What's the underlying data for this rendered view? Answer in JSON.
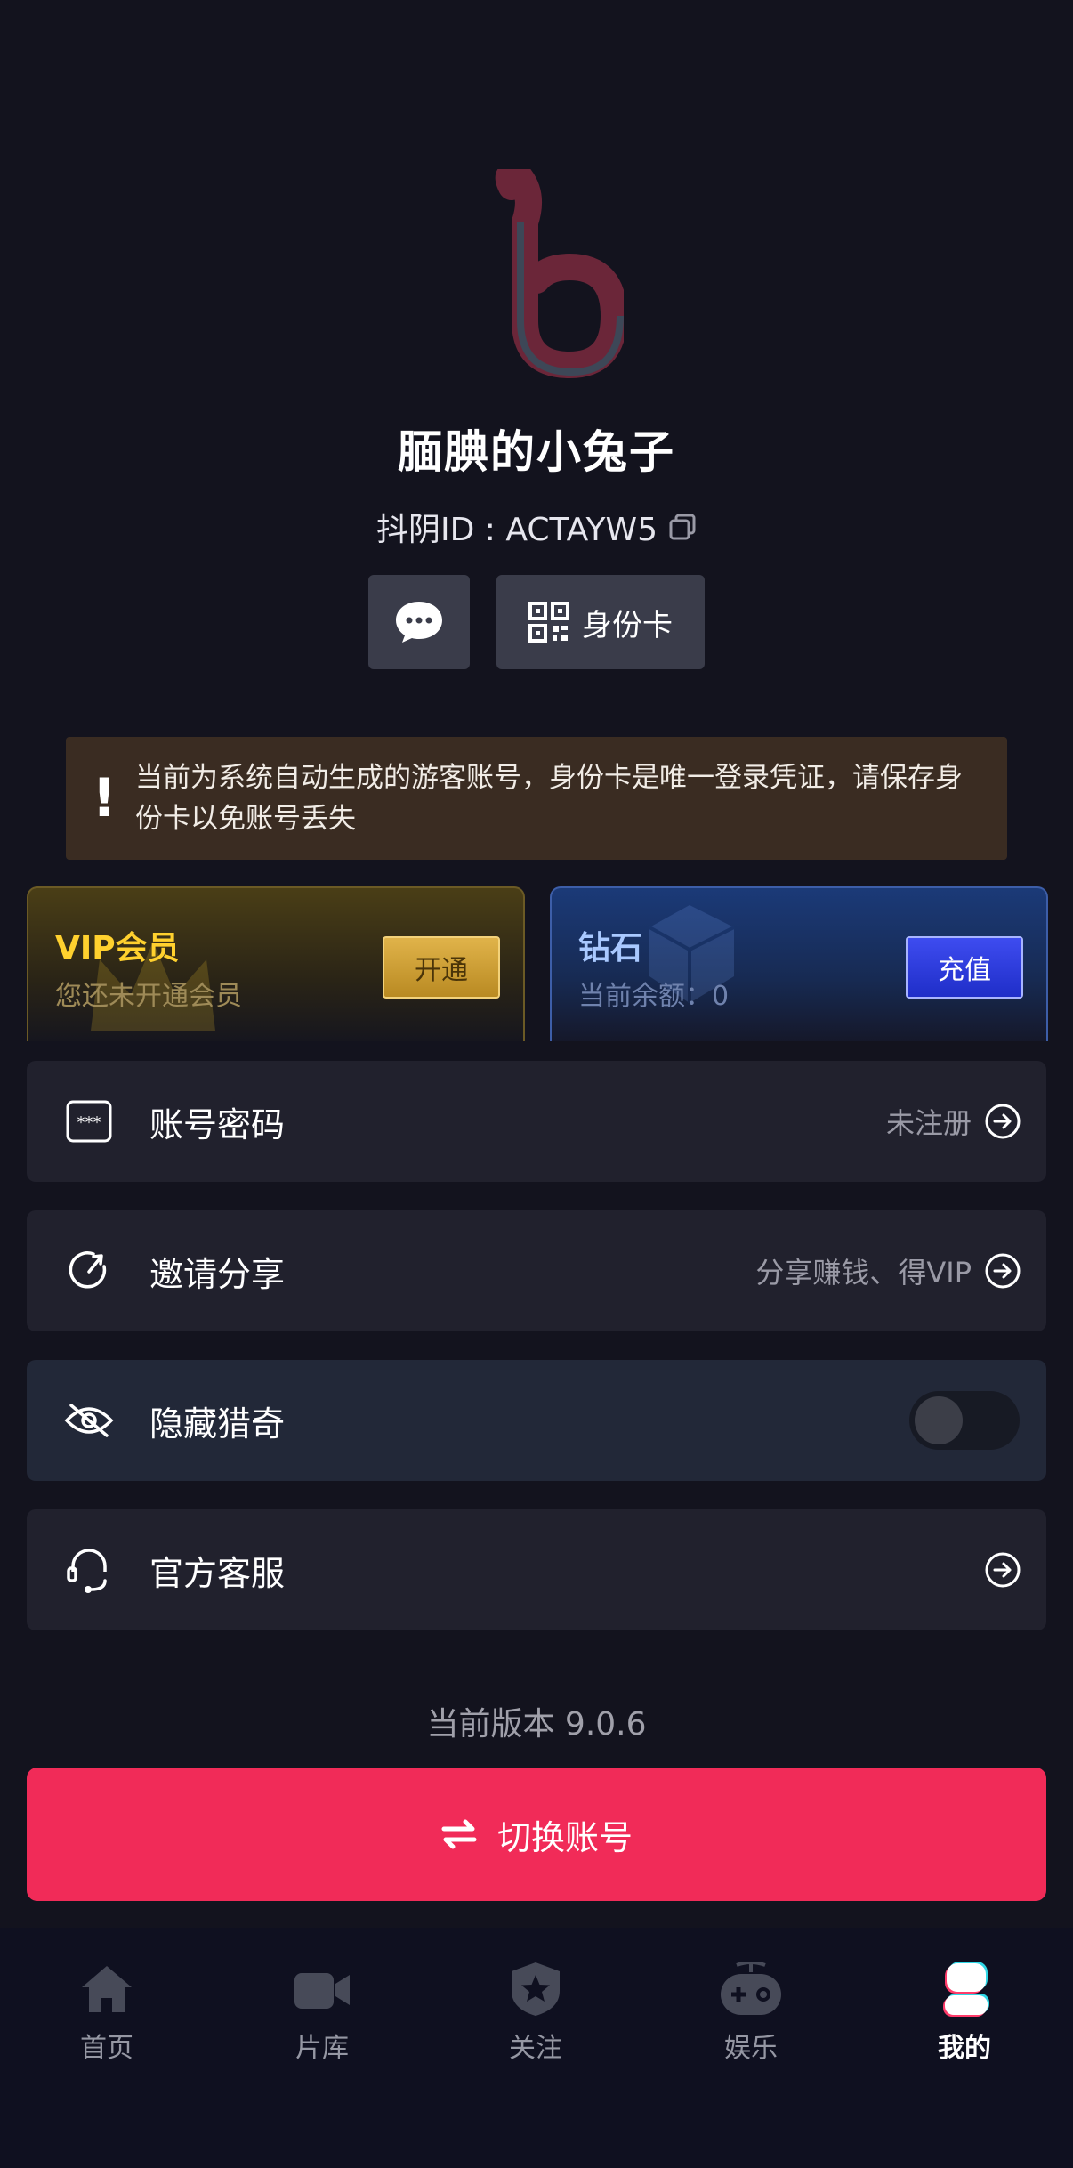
{
  "profile": {
    "nickname": "腼腆的小兔子",
    "id_text": "抖阴ID : ACTAYW5"
  },
  "actions": {
    "id_card_label": "身份卡"
  },
  "notice": {
    "icon": "!",
    "text": "当前为系统自动生成的游客账号，身份卡是唯一登录凭证，请保存身份卡以免账号丢失"
  },
  "vip": {
    "title": "VIP会员",
    "subtitle": "您还未开通会员",
    "button": "开通"
  },
  "diamond": {
    "title": "钻石",
    "balance_label": "当前余额：",
    "balance": "0",
    "button": "充值"
  },
  "menu": [
    {
      "label": "账号密码",
      "right": "未注册",
      "icon": "password-icon"
    },
    {
      "label": "邀请分享",
      "right": "分享赚钱、得VIP",
      "icon": "share-icon"
    },
    {
      "label": "隐藏猎奇",
      "toggle": false,
      "icon": "eye-hidden-icon"
    },
    {
      "label": "官方客服",
      "right": "",
      "icon": "headset-icon"
    }
  ],
  "version_text": "当前版本 9.0.6",
  "switch_account": "切换账号",
  "tabs": [
    {
      "label": "首页",
      "icon": "home-icon"
    },
    {
      "label": "片库",
      "icon": "video-camera-icon"
    },
    {
      "label": "关注",
      "icon": "star-shield-icon"
    },
    {
      "label": "娱乐",
      "icon": "gamepad-icon"
    },
    {
      "label": "我的",
      "icon": "profile-icon",
      "active": true
    }
  ],
  "colors": {
    "background": "#13131e",
    "accent": "#f12b58",
    "vip_gold": "#ffd12e",
    "diamond_blue": "#a9c9ff"
  }
}
